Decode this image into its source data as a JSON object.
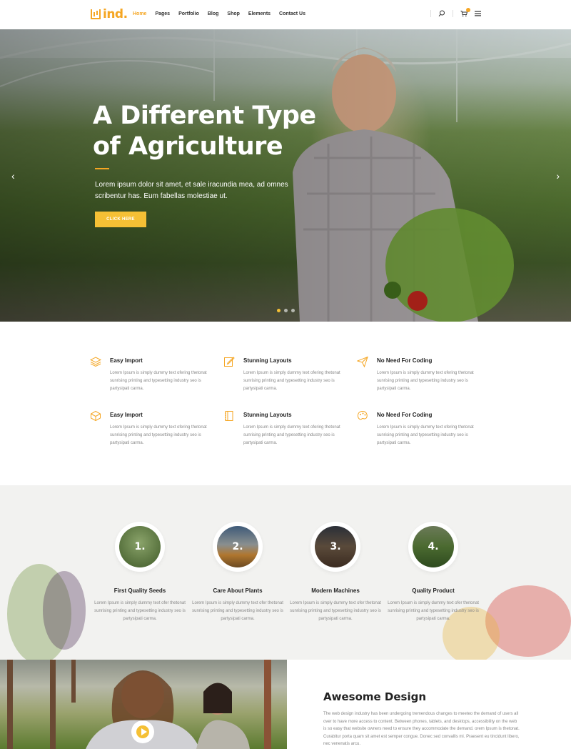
{
  "header": {
    "logo_text": "ind.",
    "nav": [
      {
        "label": "Home",
        "active": true
      },
      {
        "label": "Pages",
        "active": false
      },
      {
        "label": "Portfolio",
        "active": false
      },
      {
        "label": "Blog",
        "active": false
      },
      {
        "label": "Shop",
        "active": false
      },
      {
        "label": "Elements",
        "active": false
      },
      {
        "label": "Contact Us",
        "active": false
      }
    ],
    "icons": [
      "search-icon",
      "cart-icon",
      "menu-icon"
    ]
  },
  "hero": {
    "title_line1": "A Different Type",
    "title_line2": "of Agriculture",
    "text": "Lorem ipsum dolor sit amet, et sale iracundia mea, ad omnes scribentur has. Eum fabellas molestiae ut.",
    "button": "CLICK HERE",
    "slides_count": 3,
    "active_slide": 1
  },
  "features": [
    {
      "title": "Easy Import",
      "text": "Lorem Ipsum is simply dummy text ofering thetonat sunrising printing and typesetting industry seo is partysipati carma.",
      "icon": "layers-icon"
    },
    {
      "title": "Stunning Layouts",
      "text": "Lorem Ipsum is simply dummy text ofering thetonat sunrising printing and typesetting industry seo is partysipati carma.",
      "icon": "edit-icon"
    },
    {
      "title": "No Need For Coding",
      "text": "Lorem Ipsum is simply dummy text ofering thetonat sunrising printing and typesetting industry seo is partysipati carma.",
      "icon": "paper-plane-icon"
    },
    {
      "title": "Easy Import",
      "text": "Lorem Ipsum is simply dummy text ofering thetonat sunrising printing and typesetting industry seo is partysipati carma.",
      "icon": "box-icon"
    },
    {
      "title": "Stunning Layouts",
      "text": "Lorem Ipsum is simply dummy text ofering thetonat sunrising printing and typesetting industry seo is partysipati carma.",
      "icon": "notebook-icon"
    },
    {
      "title": "No Need For Coding",
      "text": "Lorem Ipsum is simply dummy text ofering thetonat sunrising printing and typesetting industry seo is partysipati carma.",
      "icon": "palette-icon"
    }
  ],
  "steps": [
    {
      "num": "1.",
      "title": "First Quality Seeds",
      "text": "Lorem Ipsum is simply dummy text ofer thetonat sunrising printing and typesetting industry seo is partysipati carma."
    },
    {
      "num": "2.",
      "title": "Care About Plants",
      "text": "Lorem Ipsum is simply dummy text ofer thetonat sunrising printing and typesetting industry seo is partysipati carma."
    },
    {
      "num": "3.",
      "title": "Modern Machines",
      "text": "Lorem Ipsum is simply dummy text ofer thetonat sunrising printing and typesetting industry seo is partysipati carma."
    },
    {
      "num": "4.",
      "title": "Quality Product",
      "text": "Lorem Ipsum is simply dummy text ofer thetonat sunrising printing and typesetting industry seo is partysipati carma."
    }
  ],
  "about": {
    "title": "Awesome Design",
    "text": "The web design industry has been undergoing tremendous changes to meeteo the demand of users all over to have more access to content. Between phones, tablets, and desktops, accessibility on the web is so easy that website owners need to ensure they accommodate the demand. orem Ipsum is thetonat. Curabitur porta quam sit amet est semper congue. Donec sed convallis mi. Praesent eu tincidunt libero, nec venenatis arcu."
  },
  "colors": {
    "accent": "#f5a623",
    "button": "#f5c035",
    "section_bg": "#f2f2f0"
  }
}
